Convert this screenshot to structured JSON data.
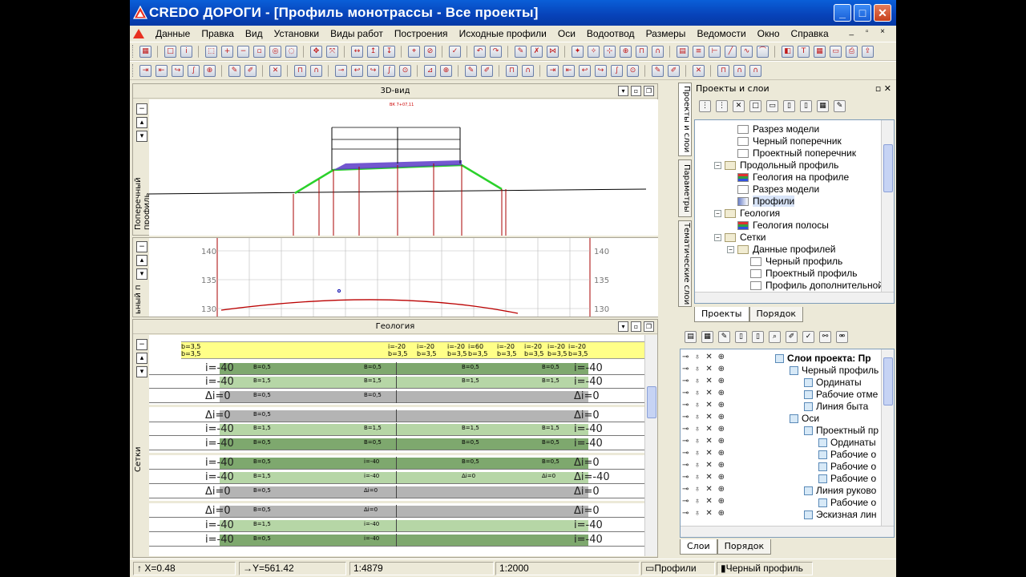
{
  "window": {
    "title": "CREDO ДОРОГИ - [Профиль монотрассы - Все проекты]",
    "controls": [
      "_",
      "□",
      "✕"
    ]
  },
  "menu": [
    "Данные",
    "Правка",
    "Вид",
    "Установки",
    "Виды работ",
    "Построения",
    "Исходные профили",
    "Оси",
    "Водоотвод",
    "Размеры",
    "Ведомости",
    "Окно",
    "Справка"
  ],
  "panes": {
    "view3d": {
      "title": "3D-вид",
      "side_label": "Поперечный профиль"
    },
    "profile": {
      "side_label": "ьный п",
      "y_ticks": [
        "140",
        "135",
        "130"
      ]
    },
    "geology": {
      "title": "Геология",
      "side_label": "Сетки"
    }
  },
  "xsection_label": "ВК 7+07,11",
  "grid": {
    "yellow": {
      "top_texts": [
        "b=3,5",
        "i=-20",
        "i=-20",
        "i=-20",
        "i=60",
        "i=-20",
        "i=-20",
        "i=-20",
        "i=-20"
      ],
      "bot_texts": [
        "b=3,5",
        "b=3,5",
        "b=3,5",
        "b=3,5",
        "b=3,5",
        "b=3,5",
        "b=3,5",
        "b=3,5",
        "b=3,5"
      ]
    },
    "rows": [
      {
        "left": "i=-40",
        "right": "i=-40",
        "mid": [
          "B=0,5",
          "B=0,5",
          "B=0,5",
          "B=0,5"
        ],
        "tone": "dark"
      },
      {
        "left": "i=-40",
        "right": "i=-40",
        "mid": [
          "B=1,5",
          "B=1,5",
          "B=1,5",
          "B=1,5"
        ],
        "tone": "light"
      },
      {
        "left": "Δi=0",
        "right": "Δi=0",
        "mid": [
          "B=0,5",
          "B=0,5"
        ],
        "tone": "gray"
      },
      {
        "left": "Δi=0",
        "right": "Δi=0",
        "mid": [
          "B=0,5"
        ],
        "tone": "gray"
      },
      {
        "left": "i=-40",
        "right": "i=-40",
        "mid": [
          "B=1,5",
          "B=1,5",
          "B=1,5",
          "B=1,5"
        ],
        "tone": "light"
      },
      {
        "left": "i=-40",
        "right": "i=-40",
        "mid": [
          "B=0,5",
          "B=0,5",
          "B=0,5",
          "B=0,5"
        ],
        "tone": "dark"
      },
      {
        "left": "i=-40",
        "right": "Δi=0",
        "mid": [
          "B=0,5",
          "i=-40",
          "B=0,5",
          "B=0,5"
        ],
        "tone": "dark"
      },
      {
        "left": "i=-40",
        "right": "Δi=-40",
        "mid": [
          "B=1,5",
          "i=-40",
          "Δi=0",
          "Δi=0"
        ],
        "tone": "light"
      },
      {
        "left": "Δi=0",
        "right": "Δi=0",
        "mid": [
          "B=0,5",
          "Δi=0",
          "",
          ""
        ],
        "tone": "gray"
      },
      {
        "left": "Δi=0",
        "right": "Δi=0",
        "mid": [
          "B=0,5",
          "Δi=0",
          "",
          ""
        ],
        "tone": "gray"
      },
      {
        "left": "i=-40",
        "right": "i=-40",
        "mid": [
          "B=1,5",
          "i=-40",
          "",
          ""
        ],
        "tone": "light"
      },
      {
        "left": "i=-40",
        "right": "i=-40",
        "mid": [
          "B=0,5",
          "i=-40",
          "",
          ""
        ],
        "tone": "dark"
      }
    ]
  },
  "status": {
    "x": "X=0.48",
    "y": "Y=561.42",
    "scale1": "1:4879",
    "scale2": "1:2000",
    "layer1": "Профили",
    "layer2": "Черный профиль"
  },
  "right_panel": {
    "title": "Проекты и слои",
    "vtabs": [
      "Проекты и слои",
      "Параметры",
      "Тематические слои"
    ],
    "tree": [
      {
        "label": "Разрез модели",
        "indent": 2,
        "icon": "plain",
        "exp": ""
      },
      {
        "label": "Черный поперечник",
        "indent": 2,
        "icon": "plain",
        "exp": ""
      },
      {
        "label": "Проектный поперечник",
        "indent": 2,
        "icon": "plain",
        "exp": ""
      },
      {
        "label": "Продольный профиль",
        "indent": 1,
        "icon": "folder",
        "exp": "−"
      },
      {
        "label": "Геология на профиле",
        "indent": 2,
        "icon": "geo",
        "exp": ""
      },
      {
        "label": "Разрез модели",
        "indent": 2,
        "icon": "plain",
        "exp": ""
      },
      {
        "label": "Профили",
        "indent": 2,
        "icon": "prof",
        "exp": "",
        "sel": true
      },
      {
        "label": "Геология",
        "indent": 1,
        "icon": "folder",
        "exp": "−"
      },
      {
        "label": "Геология полосы",
        "indent": 2,
        "icon": "geo",
        "exp": ""
      },
      {
        "label": "Сетки",
        "indent": 1,
        "icon": "folder",
        "exp": "−"
      },
      {
        "label": "Данные профилей",
        "indent": 2,
        "icon": "folder",
        "exp": "−"
      },
      {
        "label": "Черный профиль",
        "indent": 3,
        "icon": "plain",
        "exp": ""
      },
      {
        "label": "Проектный профиль",
        "indent": 3,
        "icon": "plain",
        "exp": ""
      },
      {
        "label": "Профиль дополнительной",
        "indent": 3,
        "icon": "plain",
        "exp": ""
      }
    ],
    "tabs1": [
      "Проекты",
      "Порядок"
    ],
    "layers": [
      {
        "label": "Слои проекта: Пр",
        "indent": 0,
        "bold": true
      },
      {
        "label": "Черный профиль",
        "indent": 1
      },
      {
        "label": "Ординаты",
        "indent": 2
      },
      {
        "label": "Рабочие отме",
        "indent": 2
      },
      {
        "label": "Линия быта",
        "indent": 2
      },
      {
        "label": "Оси",
        "indent": 1
      },
      {
        "label": "Проектный пр",
        "indent": 2
      },
      {
        "label": "Ординаты",
        "indent": 3
      },
      {
        "label": "Рабочие о",
        "indent": 3
      },
      {
        "label": "Рабочие о",
        "indent": 3
      },
      {
        "label": "Рабочие о",
        "indent": 3
      },
      {
        "label": "Линия руково",
        "indent": 2
      },
      {
        "label": "Рабочие о",
        "indent": 3
      },
      {
        "label": "Эскизная лин",
        "indent": 2
      }
    ],
    "tabs2": [
      "Слои",
      "Порядок"
    ]
  }
}
